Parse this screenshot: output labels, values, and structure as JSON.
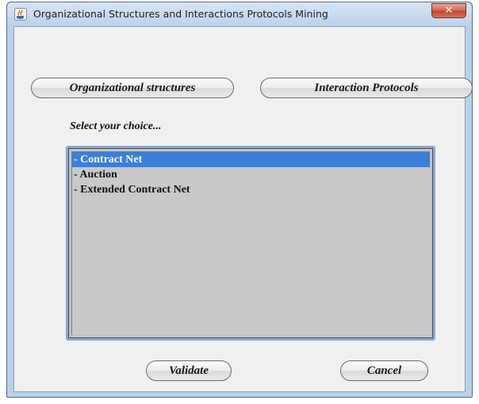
{
  "window": {
    "title": "Organizational Structures and Interactions Protocols Mining",
    "close_symbol": "✕"
  },
  "icons": {
    "app": "java-app-icon",
    "close": "close-icon"
  },
  "buttons": {
    "organizational": "Organizational structures",
    "interaction": "Interaction Protocols",
    "validate": "Validate",
    "cancel": "Cancel"
  },
  "prompt": "Select your choice...",
  "list": {
    "items": [
      {
        "label": "- Contract Net",
        "selected": true
      },
      {
        "label": "- Auction",
        "selected": false
      },
      {
        "label": "- Extended Contract Net",
        "selected": false
      }
    ]
  },
  "colors": {
    "selection": "#3b7fd9",
    "close_button": "#c2442d",
    "list_background": "#c9c9c9"
  }
}
